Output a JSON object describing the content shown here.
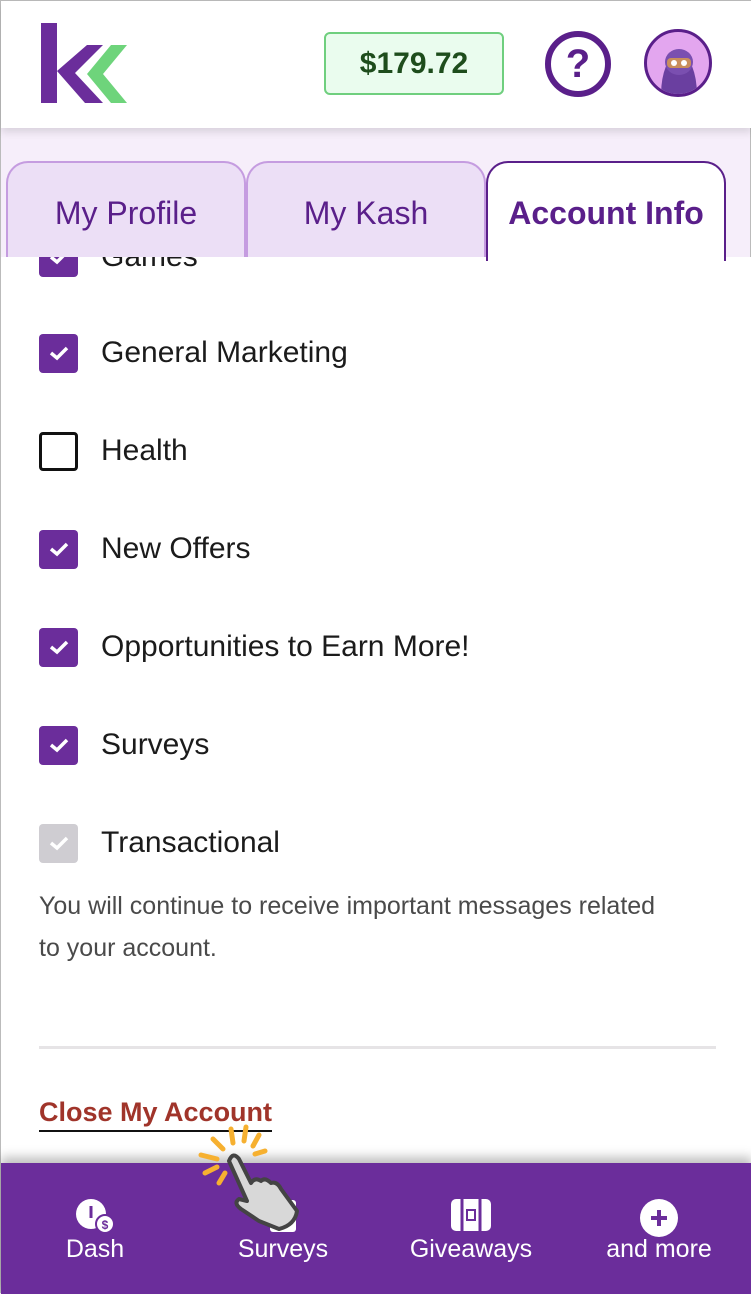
{
  "header": {
    "balance": "$179.72",
    "help_icon": "question-circle-icon",
    "avatar": "ninja-avatar"
  },
  "tabs": [
    {
      "label": "My Profile",
      "active": false
    },
    {
      "label": "My Kash",
      "active": false
    },
    {
      "label": "Account Info",
      "active": true
    }
  ],
  "preferences": [
    {
      "label": "Games",
      "checked": true
    },
    {
      "label": "General Marketing",
      "checked": true
    },
    {
      "label": "Health",
      "checked": false
    },
    {
      "label": "New Offers",
      "checked": true
    },
    {
      "label": "Opportunities to Earn More!",
      "checked": true
    },
    {
      "label": "Surveys",
      "checked": true
    },
    {
      "label": "Transactional",
      "checked": true,
      "disabled": true
    }
  ],
  "note": "You will continue to receive important messages related to your account.",
  "close_account": "Close My Account",
  "nav": [
    {
      "label": "Dash",
      "icon": "dashboard-icon"
    },
    {
      "label": "Surveys",
      "icon": "surveys-icon"
    },
    {
      "label": "Giveaways",
      "icon": "treasure-chest-icon"
    },
    {
      "label": "and more",
      "icon": "plus-circle-icon"
    }
  ],
  "colors": {
    "brand": "#6b2d9b",
    "accent": "#6fcf7e",
    "danger": "#a0342a"
  }
}
